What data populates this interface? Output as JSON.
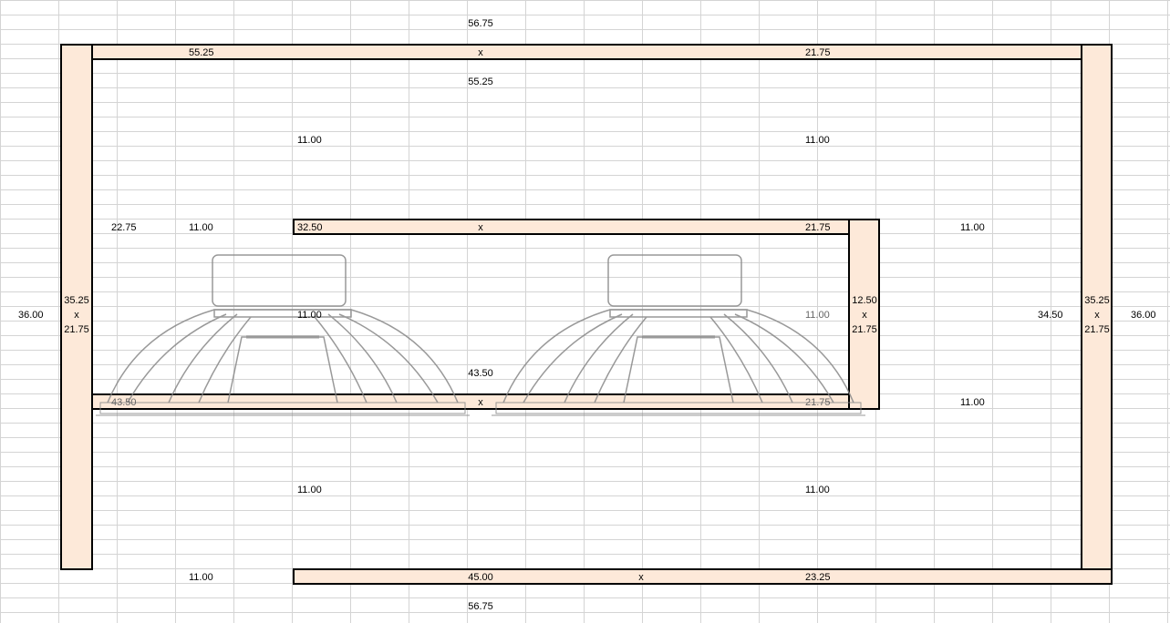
{
  "sheet": {
    "grid_color": "#d4d4d4",
    "panel_fill": "#fde9d9",
    "panel_border": "#000000"
  },
  "labels": {
    "overall_width_top": "56.75",
    "top_panel_length": "55.25",
    "top_panel_x": "x",
    "top_panel_depth": "21.75",
    "inner_width_top": "55.25",
    "gap_upper_left": "11.00",
    "gap_upper_right": "11.00",
    "left_clearance": "22.75",
    "left_gap": "11.00",
    "shelf_length": "32.50",
    "shelf_x": "x",
    "shelf_depth": "21.75",
    "right_gap_upper": "11.00",
    "left_side_length": "35.25",
    "left_side_x": "x",
    "left_side_depth": "21.75",
    "overall_height_left": "36.00",
    "center_gap_left": "11.00",
    "center_gap_right": "11.00",
    "divider_length": "12.50",
    "divider_x": "x",
    "divider_depth": "21.75",
    "inner_height_right": "34.50",
    "right_side_length": "35.25",
    "right_side_x": "x",
    "right_side_depth": "21.75",
    "overall_height_right": "36.00",
    "baffle_span": "43.50",
    "baffle_length": "43.50",
    "baffle_x": "x",
    "baffle_depth": "21.75",
    "right_gap_lower": "11.00",
    "gap_lower_left": "11.00",
    "gap_lower_right": "11.00",
    "bottom_gap": "11.00",
    "bottom_panel_length": "45.00",
    "bottom_panel_x": "x",
    "bottom_panel_depth": "23.25",
    "overall_width_bottom": "56.75"
  }
}
